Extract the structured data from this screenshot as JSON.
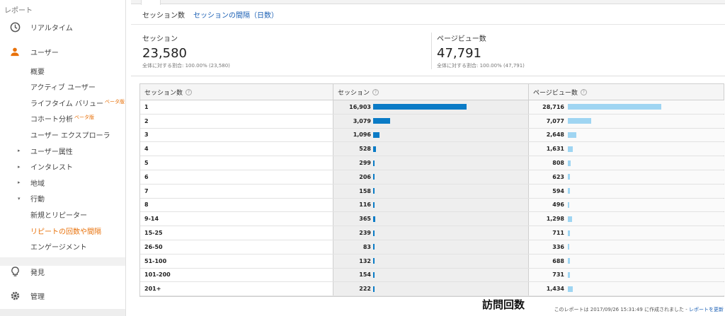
{
  "sidebar": {
    "section_title": "レポート",
    "realtime": "リアルタイム",
    "user": "ユーザー",
    "sub": [
      {
        "label": "概要",
        "arrow": "",
        "beta": "",
        "active": false
      },
      {
        "label": "アクティブ ユーザー",
        "arrow": "",
        "beta": "",
        "active": false
      },
      {
        "label": "ライフタイム バリュー",
        "arrow": "",
        "beta": "ベータ版",
        "active": false
      },
      {
        "label": "コホート分析",
        "arrow": "",
        "beta": "ベータ版",
        "active": false
      },
      {
        "label": "ユーザー エクスプローラ",
        "arrow": "",
        "beta": "",
        "active": false
      },
      {
        "label": "ユーザー属性",
        "arrow": "▸",
        "beta": "",
        "active": false
      },
      {
        "label": "インタレスト",
        "arrow": "▸",
        "beta": "",
        "active": false
      },
      {
        "label": "地域",
        "arrow": "▸",
        "beta": "",
        "active": false
      },
      {
        "label": "行動",
        "arrow": "▾",
        "beta": "",
        "active": false
      },
      {
        "label": "新規とリピーター",
        "arrow": "",
        "beta": "",
        "active": false
      },
      {
        "label": "リピートの回数や間隔",
        "arrow": "",
        "beta": "",
        "active": true
      },
      {
        "label": "エンゲージメント",
        "arrow": "",
        "beta": "",
        "active": false
      }
    ],
    "discover": "発見",
    "admin": "管理"
  },
  "tabs": {
    "sessions": "セッション数",
    "interval": "セッションの間隔（日数）"
  },
  "summary": {
    "m1": {
      "label": "セッション",
      "value": "23,580",
      "sub": "全体に対する割合: 100.00% (23,580)"
    },
    "m2": {
      "label": "ページビュー数",
      "value": "47,791",
      "sub": "全体に対する割合: 100.00% (47,791)"
    }
  },
  "table": {
    "headers": [
      "セッション数",
      "セッション",
      "ページビュー数"
    ],
    "rows": [
      {
        "count": "1",
        "sessions": "16,903",
        "pv": "28,716",
        "s": 16903,
        "p": 28716
      },
      {
        "count": "2",
        "sessions": "3,079",
        "pv": "7,077",
        "s": 3079,
        "p": 7077
      },
      {
        "count": "3",
        "sessions": "1,096",
        "pv": "2,648",
        "s": 1096,
        "p": 2648
      },
      {
        "count": "4",
        "sessions": "528",
        "pv": "1,631",
        "s": 528,
        "p": 1631
      },
      {
        "count": "5",
        "sessions": "299",
        "pv": "808",
        "s": 299,
        "p": 808
      },
      {
        "count": "6",
        "sessions": "206",
        "pv": "623",
        "s": 206,
        "p": 623
      },
      {
        "count": "7",
        "sessions": "158",
        "pv": "594",
        "s": 158,
        "p": 594
      },
      {
        "count": "8",
        "sessions": "116",
        "pv": "496",
        "s": 116,
        "p": 496
      },
      {
        "count": "9-14",
        "sessions": "365",
        "pv": "1,298",
        "s": 365,
        "p": 1298
      },
      {
        "count": "15-25",
        "sessions": "239",
        "pv": "711",
        "s": 239,
        "p": 711
      },
      {
        "count": "26-50",
        "sessions": "83",
        "pv": "336",
        "s": 83,
        "p": 336
      },
      {
        "count": "51-100",
        "sessions": "132",
        "pv": "688",
        "s": 132,
        "p": 688
      },
      {
        "count": "101-200",
        "sessions": "154",
        "pv": "731",
        "s": 154,
        "p": 731
      },
      {
        "count": "201+",
        "sessions": "222",
        "pv": "1,434",
        "s": 222,
        "p": 1434
      }
    ]
  },
  "footer": {
    "title": "訪問回数",
    "note": "このレポートは 2017/09/26 15:31:49 に作成されました - ",
    "refresh": "レポートを更新"
  },
  "colors": {
    "session_bar": "#0a7bc6",
    "pv_bar": "#9fd5f2",
    "accent": "#e8710a"
  }
}
